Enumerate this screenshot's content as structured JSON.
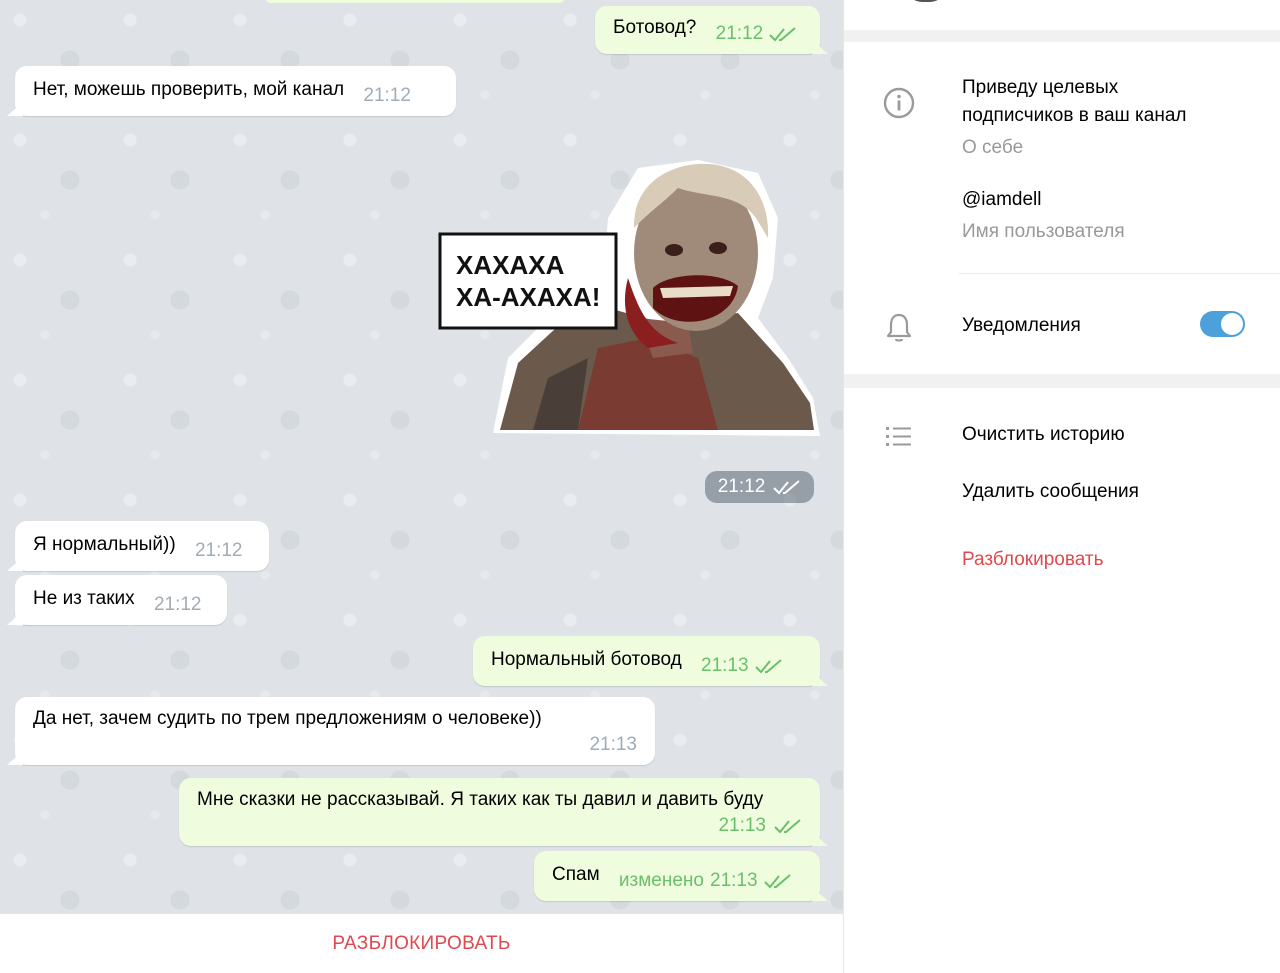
{
  "chat": {
    "messages": [
      {
        "dir": "out",
        "text": "Ботовод?",
        "time": "21:12"
      },
      {
        "dir": "in",
        "text": "Нет, можешь проверить, мой канал",
        "time": "21:12"
      },
      {
        "dir": "out",
        "type": "sticker",
        "sticker_text_line1": "ХАХАХА",
        "sticker_text_line2": "ХА-АХАХА!",
        "time": "21:12"
      },
      {
        "dir": "in",
        "text": "Я нормальный))",
        "time": "21:12"
      },
      {
        "dir": "in",
        "text": "Не из таких",
        "time": "21:12"
      },
      {
        "dir": "out",
        "text": "Нормальный ботовод",
        "time": "21:13"
      },
      {
        "dir": "in",
        "text": "Да нет, зачем судить по трем предложениям о человеке))",
        "time": "21:13"
      },
      {
        "dir": "out",
        "text": "Мне сказки не рассказывай. Я таких как ты давил и давить буду",
        "time": "21:13"
      },
      {
        "dir": "out",
        "text": "Спам",
        "edited_label": "изменено",
        "time": "21:13"
      }
    ],
    "unblock_label": "РАЗБЛОКИРОВАТЬ"
  },
  "panel": {
    "bio": "Приведу целевых подписчиков в ваш канал",
    "bio_line1": "Приведу целевых",
    "bio_line2": "подписчиков в ваш канал",
    "bio_caption": "О себе",
    "username": "@iamdell",
    "username_caption": "Имя пользователя",
    "notifications_label": "Уведомления",
    "notifications_on": true,
    "actions": {
      "clear_history": "Очистить историю",
      "delete_messages": "Удалить сообщения",
      "unblock": "Разблокировать"
    }
  },
  "colors": {
    "accent": "#4da1db",
    "danger": "#e0484f",
    "outgoing_bubble": "#effdde",
    "check_green": "#6ac06a"
  },
  "icons": [
    "info-icon",
    "bell-icon",
    "list-icon",
    "double-check-icon"
  ]
}
